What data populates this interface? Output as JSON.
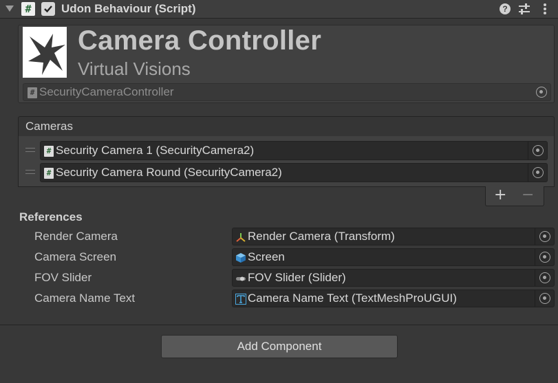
{
  "component": {
    "title": "Udon Behaviour (Script)",
    "script_icon_glyph": "#",
    "enabled": true
  },
  "banner": {
    "title": "Camera Controller",
    "subtitle": "Virtual Visions",
    "script_value": "SecurityCameraController"
  },
  "cameras": {
    "header": "Cameras",
    "items": [
      {
        "label": "Security Camera 1 (SecurityCamera2)"
      },
      {
        "label": "Security Camera Round (SecurityCamera2)"
      }
    ],
    "add_glyph": "+",
    "remove_glyph": "−"
  },
  "references": {
    "header": "References",
    "fields": [
      {
        "label": "Render Camera",
        "value": "Render Camera (Transform)",
        "icon": "transform-icon"
      },
      {
        "label": "Camera Screen",
        "value": "Screen",
        "icon": "gameobject-cube-icon"
      },
      {
        "label": "FOV Slider",
        "value": "FOV Slider (Slider)",
        "icon": "slider-icon"
      },
      {
        "label": "Camera Name Text",
        "value": "Camera Name Text (TextMeshProUGUI)",
        "icon": "textmeshpro-icon"
      }
    ]
  },
  "add_component": "Add Component",
  "colors": {
    "background": "#383838",
    "field": "#2a2a2a",
    "text": "#d2d2d2"
  }
}
